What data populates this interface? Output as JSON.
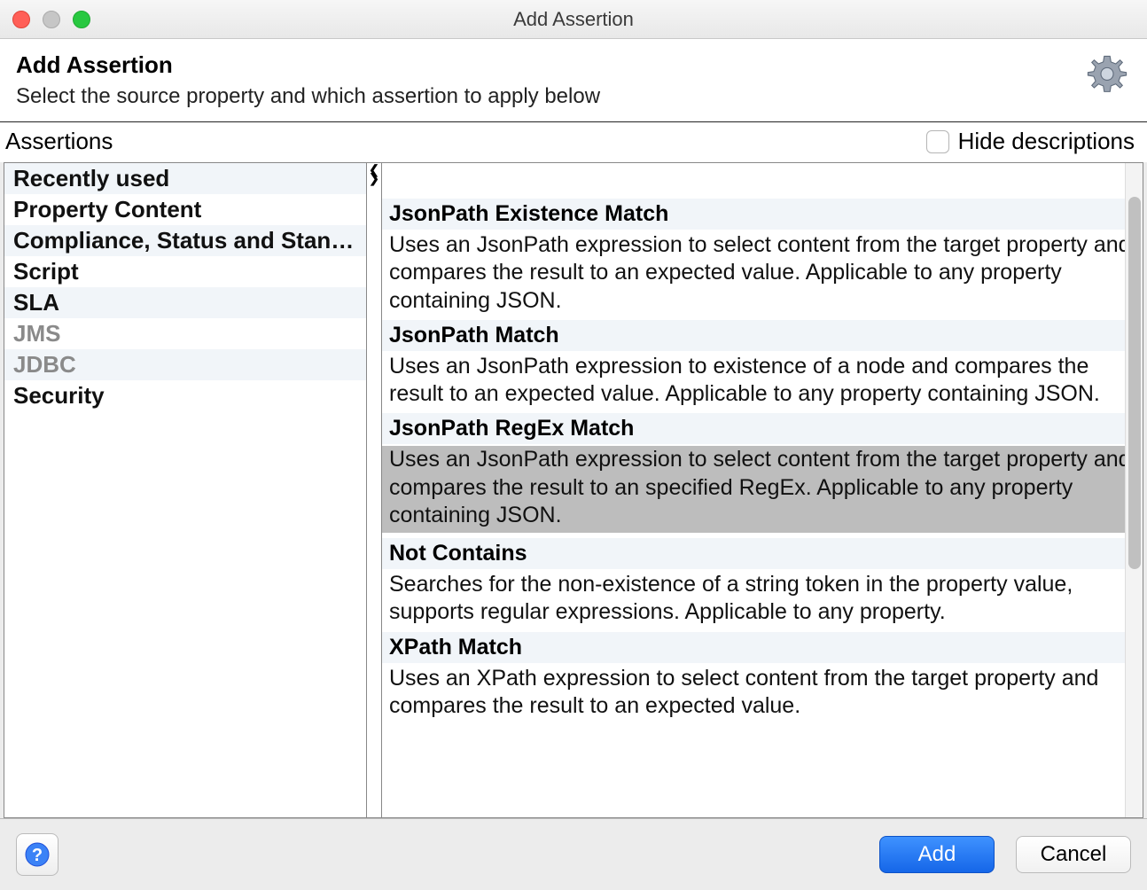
{
  "window": {
    "title": "Add Assertion"
  },
  "header": {
    "title": "Add Assertion",
    "subtitle": "Select the source property and which assertion to apply below"
  },
  "toolbar": {
    "assertions_label": "Assertions",
    "hide_descriptions_label": "Hide descriptions",
    "hide_descriptions_checked": false
  },
  "categories": [
    {
      "label": "Recently used",
      "disabled": false
    },
    {
      "label": "Property Content",
      "disabled": false
    },
    {
      "label": "Compliance, Status and Stand…",
      "disabled": false
    },
    {
      "label": "Script",
      "disabled": false
    },
    {
      "label": "SLA",
      "disabled": false
    },
    {
      "label": "JMS",
      "disabled": true
    },
    {
      "label": "JDBC",
      "disabled": true
    },
    {
      "label": "Security",
      "disabled": false
    }
  ],
  "assertions": [
    {
      "title": "JsonPath Existence Match",
      "description": "Uses an JsonPath expression to select content from the target property and compares the result to an expected value. Applicable to any property containing JSON.",
      "selected": false
    },
    {
      "title": "JsonPath Match",
      "description": "Uses an JsonPath expression to existence of a node and compares the result to an expected value. Applicable to any property containing JSON.",
      "selected": false
    },
    {
      "title": "JsonPath RegEx Match",
      "description": "Uses an JsonPath expression to select content from the target property and compares the result to an specified RegEx. Applicable to any property containing JSON.",
      "selected": true
    },
    {
      "title": "Not Contains",
      "description": "Searches for the non-existence of a string token in the property value, supports regular expressions. Applicable to any property.",
      "selected": false
    },
    {
      "title": "XPath Match",
      "description": "Uses an XPath expression to select content from the target property and compares the result to an expected value.",
      "selected": false
    }
  ],
  "footer": {
    "add_label": "Add",
    "cancel_label": "Cancel"
  }
}
